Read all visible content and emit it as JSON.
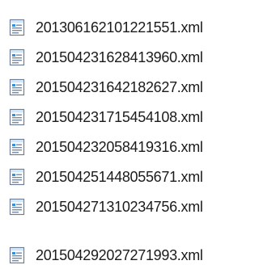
{
  "files": [
    {
      "name": "201306162101221551.xml",
      "icon": "xml-document-icon"
    },
    {
      "name": "201504231628413960.xml",
      "icon": "xml-document-icon"
    },
    {
      "name": "201504231642182627.xml",
      "icon": "xml-document-icon"
    },
    {
      "name": "201504231715454108.xml",
      "icon": "xml-document-icon"
    },
    {
      "name": "201504232058419316.xml",
      "icon": "xml-document-icon"
    },
    {
      "name": "201504251448055671.xml",
      "icon": "xml-document-icon"
    },
    {
      "name": "201504271310234756.xml",
      "icon": "xml-document-icon"
    },
    {
      "name": "201504292027271993.xml",
      "icon": "xml-document-icon"
    }
  ],
  "colors": {
    "icon_border": "#6f7e93",
    "icon_fill": "#ffffff",
    "icon_accent": "#2f8fe0",
    "icon_header": "#cfe6fb",
    "text": "#1b1b1b"
  }
}
